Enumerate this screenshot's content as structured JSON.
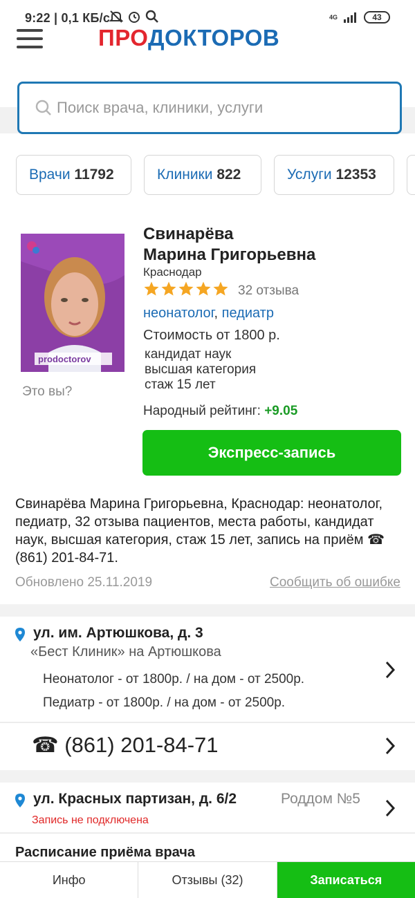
{
  "status_bar": {
    "time": "9:22 | 0,1 КБ/с",
    "network": "4G",
    "battery": "43",
    "icons": [
      "mute-icon",
      "alarm-icon",
      "search-icon",
      "signal-icon"
    ]
  },
  "header": {
    "logo_part1": "ПРО",
    "logo_part2": "ДОКТОРОВ",
    "logo_colors": {
      "red": "#e3262e",
      "blue": "#1b6bb4"
    }
  },
  "search": {
    "placeholder": "Поиск врача, клиники, услуги"
  },
  "categories": [
    {
      "label": "Врачи",
      "count": "11792"
    },
    {
      "label": "Клиники",
      "count": "822"
    },
    {
      "label": "Услуги",
      "count": "12353"
    }
  ],
  "doctor": {
    "name_line1": "Свинарёва",
    "name_line2": "Марина Григорьевна",
    "city": "Краснодар",
    "stars": 5,
    "reviews": "32 отзыва",
    "spec1": "неонатолог",
    "spec_sep": ",",
    "spec2": "педиатр",
    "price": "Стоимость от 1800 р.",
    "degree": "кандидат наук",
    "category": "высшая категория",
    "experience": "стаж 15 лет",
    "rating_label": "Народный рейтинг:",
    "rating_value": "+9.05",
    "its_you": "Это вы?",
    "photo_watermark": "prodoctorov",
    "express_button": "Экспресс-запись"
  },
  "description": "Свинарёва Марина Григорьевна, Краснодар: неонатолог, педиатр, 32 отзыва пациентов, места работы, кандидат наук, высшая категория, стаж 15 лет, запись на приём ☎ (861) 201-84-71.",
  "updated": "Обновлено 25.11.2019",
  "report_error": "Сообщить об ошибке",
  "workplaces": [
    {
      "address": "ул. им. Артюшкова, д. 3",
      "clinic": "«Бест Клиник» на Артюшкова",
      "services": [
        "Неонатолог - от 1800р. / на дом - от 2500р.",
        "Педиатр - от 1800р. / на дом - от 2500р."
      ],
      "phone": "☎ (861) 201-84-71"
    },
    {
      "address": "ул. Красных партизан, д. 6/2",
      "clinic": "Роддом №5",
      "status": "Запись не подключена"
    }
  ],
  "schedule_title": "Расписание приёма врача",
  "tabbar": {
    "info": "Инфо",
    "reviews": "Отзывы (32)",
    "book": "Записаться"
  }
}
